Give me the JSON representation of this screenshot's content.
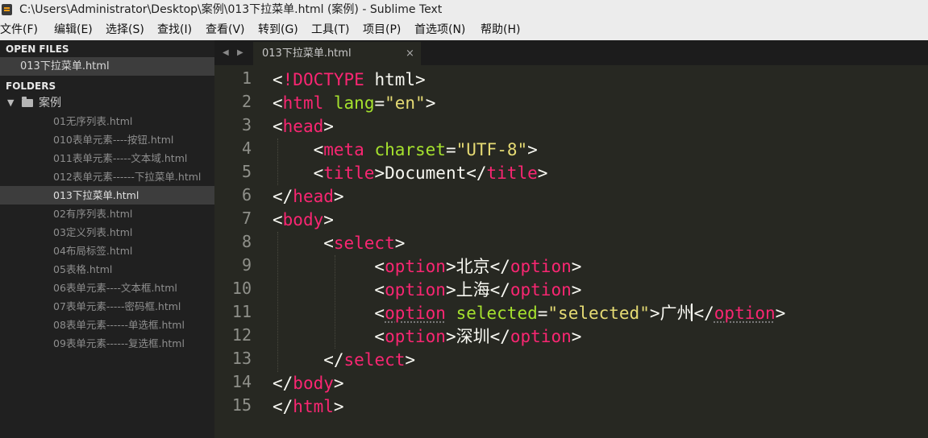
{
  "window": {
    "title": "C:\\Users\\Administrator\\Desktop\\案例\\013下拉菜单.html (案例) - Sublime Text"
  },
  "menu": [
    "文件(F)",
    "编辑(E)",
    "选择(S)",
    "查找(I)",
    "查看(V)",
    "转到(G)",
    "工具(T)",
    "项目(P)",
    "首选项(N)",
    "帮助(H)"
  ],
  "sidebar": {
    "open_files_label": "OPEN FILES",
    "open_file": "013下拉菜单.html",
    "folders_label": "FOLDERS",
    "folder_name": "案例",
    "files": [
      "01无序列表.html",
      "010表单元素----按钮.html",
      "011表单元素-----文本域.html",
      "012表单元素------下拉菜单.html",
      "013下拉菜单.html",
      "02有序列表.html",
      "03定义列表.html",
      "04布局标签.html",
      "05表格.html",
      "06表单元素----文本框.html",
      "07表单元素-----密码框.html",
      "08表单元素------单选框.html",
      "09表单元素------复选框.html"
    ],
    "active_index": 4
  },
  "tabs": [
    {
      "label": "013下拉菜单.html",
      "close": "×"
    }
  ],
  "tab_nav": {
    "prev": "◀",
    "next": "▶"
  },
  "editor": {
    "current_line": 11,
    "line_numbers": [
      "1",
      "2",
      "3",
      "4",
      "5",
      "6",
      "7",
      "8",
      "9",
      "10",
      "11",
      "12",
      "13",
      "14",
      "15"
    ],
    "lines": [
      "<!DOCTYPE html>",
      "<html lang=\"en\">",
      "<head>",
      "    <meta charset=\"UTF-8\">",
      "    <title>Document</title>",
      "</head>",
      "<body>",
      "     <select>",
      "          <option>北京</option>",
      "          <option>上海</option>",
      "          <option selected=\"selected\">广州</option>",
      "          <option>深圳</option>",
      "     </select>",
      "</body>",
      "</html>"
    ]
  },
  "colors": {
    "tag": "#f92672",
    "attr": "#a6e22e",
    "string": "#e6db74",
    "text": "#f8f8f2",
    "background": "#272822"
  }
}
